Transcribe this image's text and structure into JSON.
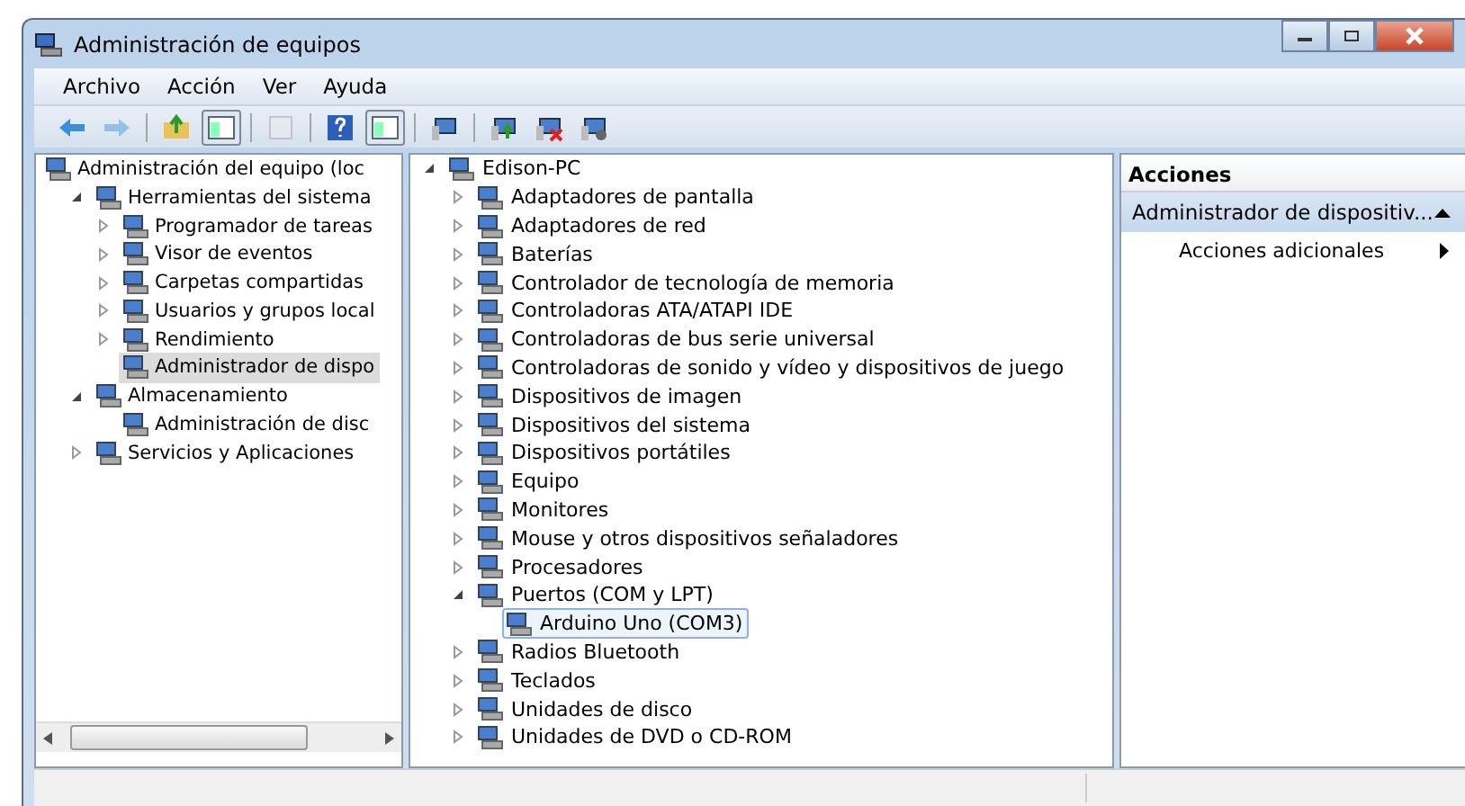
{
  "window": {
    "title": "Administración de equipos"
  },
  "menu": [
    "Archivo",
    "Acción",
    "Ver",
    "Ayuda"
  ],
  "toolbar": [
    {
      "kind": "back",
      "pressed": false
    },
    {
      "kind": "forward",
      "pressed": false
    },
    {
      "kind": "up",
      "pressed": false
    },
    {
      "kind": "tree",
      "pressed": true
    },
    {
      "kind": "properties",
      "pressed": false
    },
    {
      "kind": "help",
      "pressed": false
    },
    {
      "kind": "actionpane",
      "pressed": true
    },
    {
      "kind": "scan",
      "pressed": false
    },
    {
      "kind": "update",
      "pressed": false
    },
    {
      "kind": "disable",
      "pressed": false
    },
    {
      "kind": "uninstall",
      "pressed": false
    }
  ],
  "left_tree": [
    {
      "label": "Administración del equipo (loc",
      "selected": false,
      "children": [
        {
          "label": "Herramientas del sistema",
          "expanded": true,
          "selected": false,
          "children": [
            {
              "label": "Programador de tareas",
              "expanded": false,
              "selected": false
            },
            {
              "label": "Visor de eventos",
              "expanded": false,
              "selected": false
            },
            {
              "label": "Carpetas compartidas",
              "expanded": false,
              "selected": false
            },
            {
              "label": "Usuarios y grupos local",
              "expanded": false,
              "selected": false
            },
            {
              "label": "Rendimiento",
              "expanded": false,
              "selected": false
            },
            {
              "label": "Administrador de dispo",
              "selected": true
            }
          ]
        },
        {
          "label": "Almacenamiento",
          "expanded": true,
          "selected": false,
          "children": [
            {
              "label": "Administración de disc",
              "selected": false
            }
          ]
        },
        {
          "label": "Servicios y Aplicaciones",
          "expanded": false,
          "selected": false
        }
      ]
    }
  ],
  "device_tree": [
    {
      "label": "Edison-PC",
      "expanded": true,
      "selected": false,
      "children": [
        {
          "label": "Adaptadores de pantalla",
          "expanded": false,
          "selected": false
        },
        {
          "label": "Adaptadores de red",
          "expanded": false,
          "selected": false
        },
        {
          "label": "Baterías",
          "expanded": false,
          "selected": false
        },
        {
          "label": "Controlador de tecnología de memoria",
          "expanded": false,
          "selected": false
        },
        {
          "label": "Controladoras ATA/ATAPI IDE",
          "expanded": false,
          "selected": false
        },
        {
          "label": "Controladoras de bus serie universal",
          "expanded": false,
          "selected": false
        },
        {
          "label": "Controladoras de sonido y vídeo y dispositivos de juego",
          "expanded": false,
          "selected": false
        },
        {
          "label": "Dispositivos de imagen",
          "expanded": false,
          "selected": false
        },
        {
          "label": "Dispositivos del sistema",
          "expanded": false,
          "selected": false
        },
        {
          "label": "Dispositivos portátiles",
          "expanded": false,
          "selected": false
        },
        {
          "label": "Equipo",
          "expanded": false,
          "selected": false
        },
        {
          "label": "Monitores",
          "expanded": false,
          "selected": false
        },
        {
          "label": "Mouse y otros dispositivos señaladores",
          "expanded": false,
          "selected": false
        },
        {
          "label": "Procesadores",
          "expanded": false,
          "selected": false
        },
        {
          "label": "Puertos (COM y LPT)",
          "expanded": true,
          "selected": false,
          "children": [
            {
              "label": "Arduino Uno (COM3)",
              "selected": true
            }
          ]
        },
        {
          "label": "Radios Bluetooth",
          "expanded": false,
          "selected": false
        },
        {
          "label": "Teclados",
          "expanded": false,
          "selected": false
        },
        {
          "label": "Unidades de disco",
          "expanded": false,
          "selected": false
        },
        {
          "label": "Unidades de DVD o CD-ROM",
          "expanded": false,
          "selected": false
        }
      ]
    }
  ],
  "actions": {
    "header": "Acciones",
    "section": {
      "title": "Administrador de dispositiv...",
      "expanded": true
    },
    "items": [
      "Acciones adicionales"
    ]
  }
}
